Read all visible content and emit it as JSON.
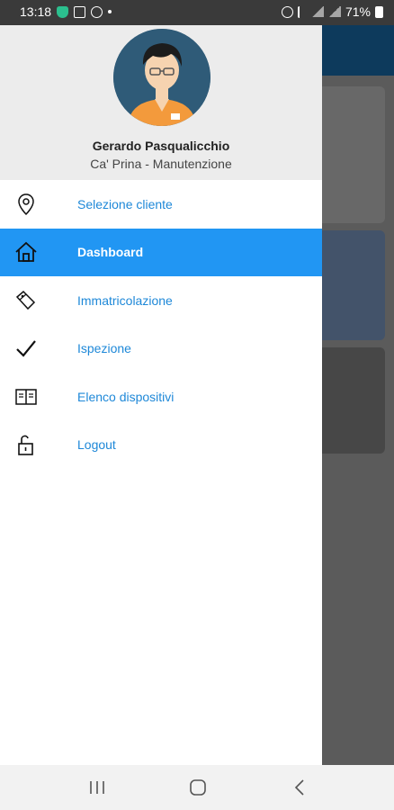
{
  "status_bar": {
    "time": "13:18",
    "battery": "71%",
    "left_icons": [
      "shield-icon",
      "image-icon",
      "whatsapp-icon",
      "dot-icon"
    ],
    "right_icons": [
      "alarm-icon",
      "mute-icon",
      "4g-signal-icon",
      "signal-icon",
      "battery-icon"
    ]
  },
  "user": {
    "name": "Gerardo Pasqualicchio",
    "organization": "Ca' Prina - Manutenzione"
  },
  "menu": {
    "active": "Dashboard",
    "accent_color": "#2196f3",
    "link_color": "#1e88d8",
    "items": [
      {
        "label": "Selezione cliente",
        "icon": "location-pin-icon"
      },
      {
        "label": "Dashboard",
        "icon": "home-icon"
      },
      {
        "label": "Immatricolazione",
        "icon": "tags-icon"
      },
      {
        "label": "Ispezione",
        "icon": "checkmark-icon"
      },
      {
        "label": "Elenco dispositivi",
        "icon": "book-icon"
      },
      {
        "label": "Logout",
        "icon": "unlock-icon"
      }
    ]
  },
  "nav_bar": {
    "buttons": [
      "recent-apps-icon",
      "home-button-icon",
      "back-icon"
    ]
  }
}
